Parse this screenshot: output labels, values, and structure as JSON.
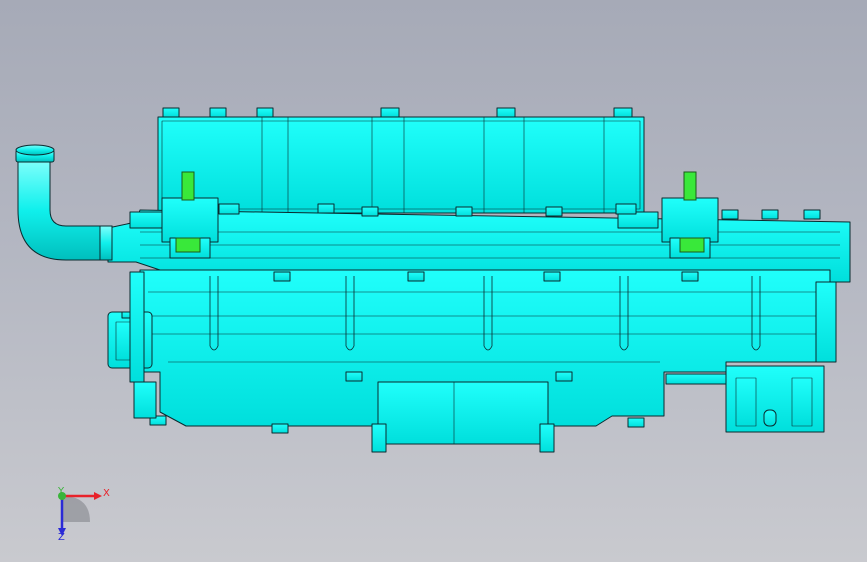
{
  "viewport": {
    "background_top": "#a6aab7",
    "background_bottom": "#c9cacf",
    "model_color": "#00f5f2",
    "model_shade": "#00d6d4",
    "edge_color": "#0a2a2e",
    "highlight_color": "#39e83a"
  },
  "triad": {
    "x_label": "X",
    "y_label": "Y",
    "z_label": "Z",
    "x_color": "#e8222a",
    "y_color": "#3ab43a",
    "z_color": "#2a2ad6"
  }
}
